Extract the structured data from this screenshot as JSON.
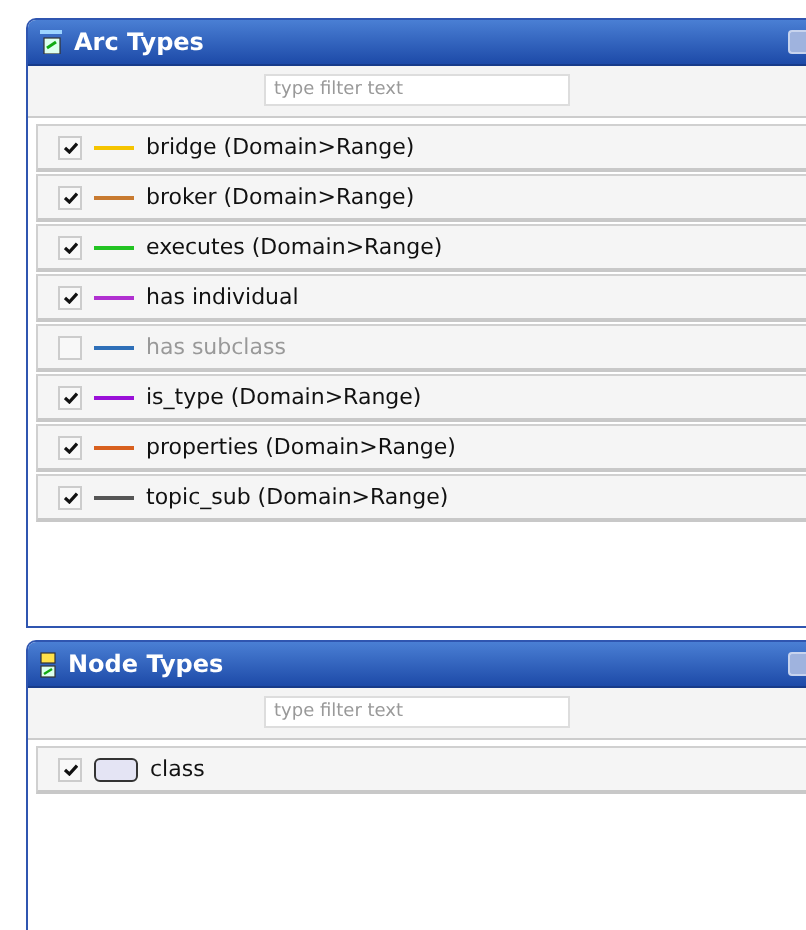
{
  "panels": [
    {
      "title": "Arc Types",
      "kind": "arcs",
      "filter": {
        "placeholder": "type filter text"
      },
      "items": [
        {
          "label": "bridge (Domain>Range)",
          "checked": true,
          "color": "#f5c400"
        },
        {
          "label": "broker (Domain>Range)",
          "checked": true,
          "color": "#c87a30"
        },
        {
          "label": "executes (Domain>Range)",
          "checked": true,
          "color": "#22c322"
        },
        {
          "label": "has individual",
          "checked": true,
          "color": "#b030d0"
        },
        {
          "label": "has subclass",
          "checked": false,
          "color": "#2e6fb8"
        },
        {
          "label": "is_type (Domain>Range)",
          "checked": true,
          "color": "#9a10d8"
        },
        {
          "label": "properties (Domain>Range)",
          "checked": true,
          "color": "#d8601e"
        },
        {
          "label": "topic_sub (Domain>Range)",
          "checked": true,
          "color": "#555555"
        }
      ]
    },
    {
      "title": "Node Types",
      "kind": "nodes",
      "filter": {
        "placeholder": "type filter text"
      },
      "items": [
        {
          "label": "class",
          "checked": true,
          "color": "#e4e4f4"
        }
      ]
    }
  ]
}
